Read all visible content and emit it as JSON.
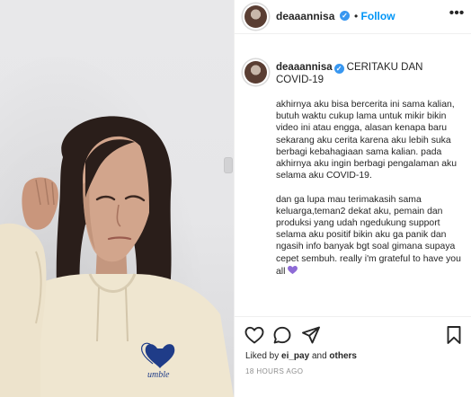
{
  "post": {
    "username": "deaaannisa",
    "follow_separator": "•",
    "follow_label": "Follow",
    "more_label": "•••",
    "caption_title": "CERITAKU DAN COVID-19",
    "caption_body": "akhirnya aku bisa bercerita ini sama kalian, butuh waktu cukup lama untuk mikir bikin video ini atau engga, alasan kenapa baru sekarang aku cerita karena aku lebih suka berbagi kebahagiaan sama kalian. pada akhirnya aku ingin berbagi pengalaman aku selama aku COVID-19.\n\ndan ga lupa mau terimakasih sama keluarga,teman2 dekat aku, pemain dan produksi yang udah ngedukung support selama aku positif bikin aku ga panik dan ngasih info banyak bgt soal gimana supaya cepet sembuh. really i'm grateful to have you all",
    "liked_by_prefix": "Liked by",
    "liked_by_user": "ei_pay",
    "liked_by_and": "and",
    "liked_by_others": "others",
    "timestamp": "18 HOURS AGO"
  },
  "hoodie_logo_text": "umble",
  "colors": {
    "accent": "#0095f6",
    "verified": "#3897f0",
    "text": "#262626",
    "muted": "#8e8e8e",
    "heart_emoji": "#8e6bd6"
  },
  "icons": {
    "like": "heart-icon",
    "comment": "comment-icon",
    "share": "share-icon",
    "save": "bookmark-icon",
    "verified": "verified-badge-icon"
  }
}
